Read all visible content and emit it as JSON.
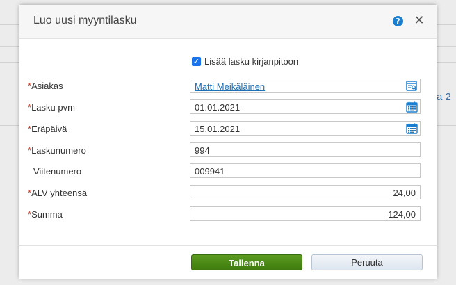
{
  "background": {
    "partial_link_text": "a 2"
  },
  "dialog": {
    "title": "Luo uusi myyntilasku",
    "help_icon": "?",
    "close_icon": "✕",
    "checkbox": {
      "label": "Lisää lasku kirjanpitoon",
      "checked": true
    },
    "required_marker": "*",
    "fields": {
      "customer": {
        "label": "Asiakas",
        "value": "Matti Meikäläinen",
        "icon": "search-list-icon"
      },
      "invoice_date": {
        "label": "Lasku pvm",
        "value": "01.01.2021",
        "icon": "calendar-icon"
      },
      "due_date": {
        "label": "Eräpäivä",
        "value": "15.01.2021",
        "icon": "calendar-icon"
      },
      "invoice_number": {
        "label": "Laskunumero",
        "value": "994"
      },
      "reference_number": {
        "label": "Viitenumero",
        "value": "009941"
      },
      "vat_total": {
        "label": "ALV yhteensä",
        "value": "24,00"
      },
      "total": {
        "label": "Summa",
        "value": "124,00"
      }
    },
    "buttons": {
      "save": "Tallenna",
      "cancel": "Peruuta"
    },
    "colors": {
      "save_button": "#4a8c16",
      "required_marker": "#c0392b",
      "link": "#1f6fb5",
      "icon_blue": "#1a7fd1"
    }
  }
}
